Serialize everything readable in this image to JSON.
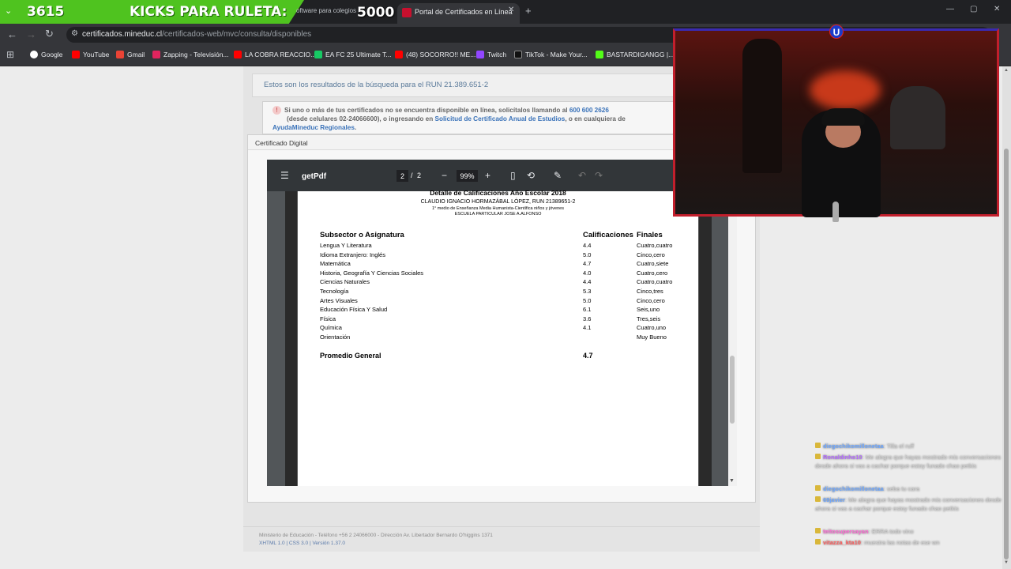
{
  "stream": {
    "counter": "3615",
    "banner_text": "KICKS PARA RULETA:",
    "kicks_value": "5000"
  },
  "browser": {
    "inactive_tab_label": "oftware para colegios",
    "active_tab_label": "Portal de Certificados en Línea",
    "url_host": "certificados.mineduc.cl",
    "url_path": "/certificados-web/mvc/consulta/disponibles",
    "bookmarks": [
      {
        "label": "Google",
        "color": "#4285f4"
      },
      {
        "label": "YouTube",
        "color": "#ff0000"
      },
      {
        "label": "Gmail",
        "color": "#ea4335"
      },
      {
        "label": "Zapping - Televisión...",
        "color": "#e0245e"
      },
      {
        "label": "LA COBRA REACCIO...",
        "color": "#ff0000"
      },
      {
        "label": "EA FC 25 Ultimate T...",
        "color": "#17c964"
      },
      {
        "label": "(48) SOCORRO!! ME...",
        "color": "#ff0000"
      },
      {
        "label": "Twitch",
        "color": "#9146ff"
      },
      {
        "label": "TikTok - Make Your...",
        "color": "#111111"
      },
      {
        "label": "BASTARDIGANGG |...",
        "color": "#53fc18"
      }
    ]
  },
  "page": {
    "results_heading": "Estos son los resultados de la búsqueda para el RUN 21.389.651-2",
    "notice_text_1": "Si uno o más de tus certificados no se encuentra disponible en línea, solicítalos llamando al",
    "notice_phone": "600 600 2626",
    "notice_text_2": "(desde celulares 02-24066600), o ingresando en",
    "notice_link": "Solicitud de Certificado Anual de Estudios",
    "notice_text_3": ", o en cualquiera de",
    "notice_link_2": "AyudaMineduc Regionales",
    "notice_text_4": ".",
    "modal_title": "Certificado Digital",
    "footer_text": "Ministerio de Educación - Teléfono +56 2 24066000 - Dirección Av. Libertador Bernardo O'higgins 1371",
    "footer_links": "XHTML 1.0 | CSS 3.0 | Versión 1.37.0"
  },
  "pdf": {
    "filename": "getPdf",
    "page_current": "2",
    "page_total": "2",
    "zoom": "99%",
    "doc_title": "Detalle de Calificaciones Año Escolar 2018",
    "student_line": "CLAUDIO IGNACIO HORMAZÁBAL LÓPEZ, RUN 21389651-2",
    "course_line": "1° medio de Enseñanza Media Humanista-Científica niños y jóvenes",
    "school_line": "ESCUELA PARTICULAR JOSE A.ALFONSO",
    "col_subject": "Subsector o Asignatura",
    "col_grades": "Calificaciones",
    "col_finals": "Finales",
    "rows": [
      {
        "subject": "Lengua Y Literatura",
        "grade": "4.4",
        "final": "Cuatro,cuatro"
      },
      {
        "subject": "Idioma Extranjero: Inglés",
        "grade": "5.0",
        "final": "Cinco,cero"
      },
      {
        "subject": "Matemática",
        "grade": "4.7",
        "final": "Cuatro,siete"
      },
      {
        "subject": "Historia, Geografía Y Ciencias Sociales",
        "grade": "4.0",
        "final": "Cuatro,cero"
      },
      {
        "subject": "Ciencias Naturales",
        "grade": "4.4",
        "final": "Cuatro,cuatro"
      },
      {
        "subject": "Tecnología",
        "grade": "5.3",
        "final": "Cinco,tres"
      },
      {
        "subject": "Artes Visuales",
        "grade": "5.0",
        "final": "Cinco,cero"
      },
      {
        "subject": "Educación Física Y Salud",
        "grade": "6.1",
        "final": "Seis,uno"
      },
      {
        "subject": "Física",
        "grade": "3.6",
        "final": "Tres,seis"
      },
      {
        "subject": "Química",
        "grade": "4.1",
        "final": "Cuatro,uno"
      },
      {
        "subject": "Orientación",
        "grade": "",
        "final": "Muy Bueno"
      }
    ],
    "average_label": "Promedio General",
    "average_value": "4.7"
  },
  "cam": {
    "badge": "U"
  },
  "chat": [
    {
      "user": "diegochikomillonetaa",
      "color": "#6fa8ff",
      "text": "Tilla el ruff"
    },
    {
      "user": "Ronaldinho10",
      "color": "#b56cff",
      "text": "Me alegra que hayas mostrado mis conversaciones desde ahora si vas a cachar porque estoy funado chao petkis"
    },
    {
      "user": "diegochikomillonetaa",
      "color": "#6fa8ff",
      "text": "seba tu cara"
    },
    {
      "user": "69javier",
      "color": "#6fa8ff",
      "text": "Me alegra que hayas mostrado mis conversaciones desde ahora si vas a cachar porque estoy funado chao petkis"
    },
    {
      "user": "teitosupersayan",
      "color": "#ff6ad5",
      "text": "ERRA todo vino"
    },
    {
      "user": "vitazza_kta10",
      "color": "#ff6060",
      "text": "muestra las notas de ese wn"
    }
  ]
}
